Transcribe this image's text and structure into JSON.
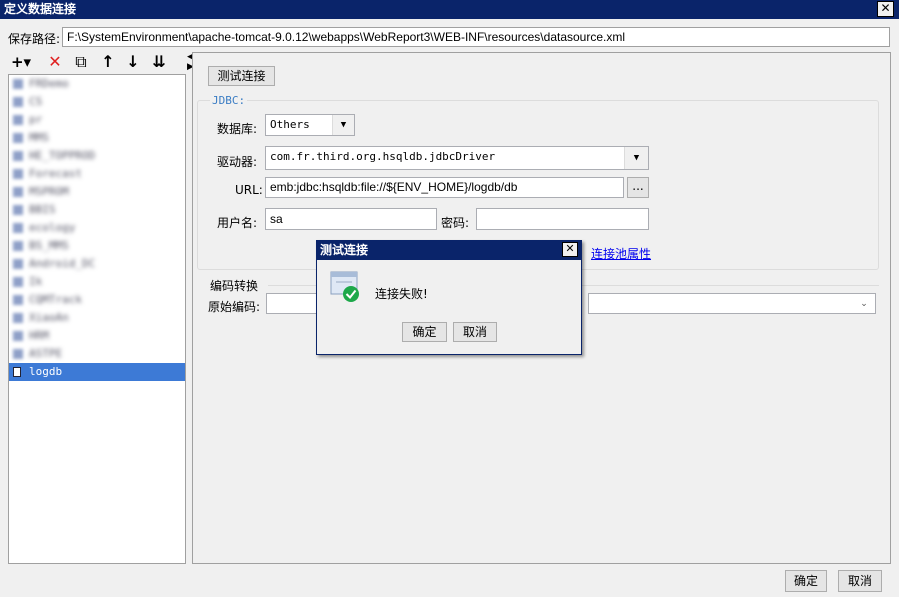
{
  "window": {
    "title": "定义数据连接",
    "close_glyph": "✕"
  },
  "save_path": {
    "label": "保存路径:",
    "value": "F:\\SystemEnvironment\\apache-tomcat-9.0.12\\webapps\\WebReport3\\WEB-INF\\resources\\datasource.xml"
  },
  "toolbar": {
    "add": "+▾",
    "delete": "✕",
    "copy": "⧉",
    "move_up": "↑",
    "move_down": "↓",
    "sort": "⇊"
  },
  "tree": {
    "items": [
      {
        "label": "FRDemo"
      },
      {
        "label": "CS"
      },
      {
        "label": "pr"
      },
      {
        "label": "MMS"
      },
      {
        "label": "HE_TOPPROD"
      },
      {
        "label": "Forecast"
      },
      {
        "label": "MSPROM"
      },
      {
        "label": "BBIS"
      },
      {
        "label": "ecology"
      },
      {
        "label": "BS_MMS"
      },
      {
        "label": "Android_DC"
      },
      {
        "label": "Ik"
      },
      {
        "label": "CQMTrack"
      },
      {
        "label": "XiaoAn"
      },
      {
        "label": "HRM"
      },
      {
        "label": "ASTPE"
      }
    ],
    "selected": {
      "label": "logdb"
    }
  },
  "test_connection_button": "测试连接",
  "jdbc": {
    "legend": "JDBC:",
    "database_label": "数据库:",
    "database_value": "Others",
    "driver_label": "驱动器:",
    "driver_value": "com.fr.third.org.hsqldb.jdbcDriver",
    "url_label": "URL:",
    "url_value": "emb:jdbc:hsqldb:file://${ENV_HOME}/logdb/db",
    "url_browse": "...",
    "username_label": "用户名:",
    "username_value": "sa",
    "password_label": "密码:",
    "password_value": "",
    "pool_link": "连接池属性"
  },
  "encoding": {
    "title": "编码转换",
    "original_label": "原始编码:",
    "original_value": "",
    "target_value": ""
  },
  "dialog": {
    "title": "测试连接",
    "close_glyph": "✕",
    "message": "连接失败!",
    "ok": "确定",
    "cancel": "取消"
  },
  "footer": {
    "ok": "确定",
    "cancel": "取消"
  }
}
